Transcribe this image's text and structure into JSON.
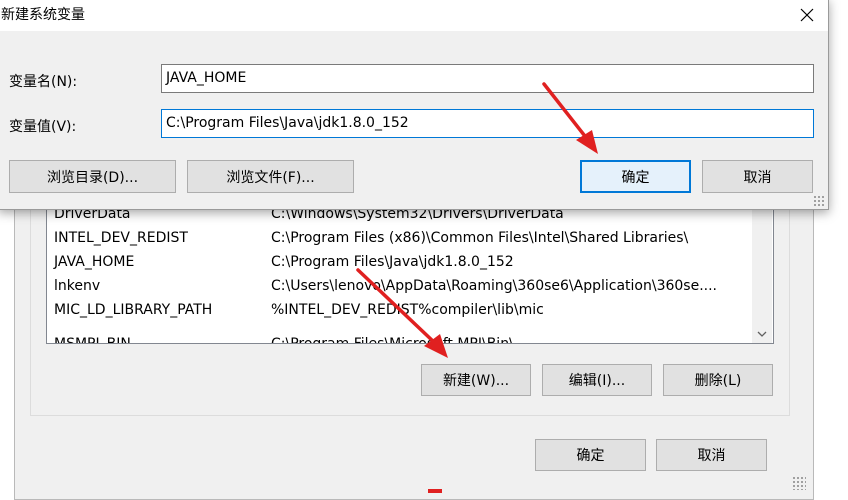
{
  "dialog": {
    "title": "新建系统变量",
    "name_label": "变量名(N):",
    "name_value": "JAVA_HOME",
    "value_label": "变量值(V):",
    "value_value": "C:\\Program Files\\Java\\jdk1.8.0_152",
    "browse_dir": "浏览目录(D)...",
    "browse_file": "浏览文件(F)...",
    "ok": "确定",
    "cancel": "取消",
    "close_icon": "close-icon"
  },
  "parent": {
    "rows": [
      {
        "name": "DriverData",
        "value": "C:\\Windows\\System32\\Drivers\\DriverData"
      },
      {
        "name": "INTEL_DEV_REDIST",
        "value": "C:\\Program Files (x86)\\Common Files\\Intel\\Shared Libraries\\"
      },
      {
        "name": "JAVA_HOME",
        "value": "C:\\Program Files\\Java\\jdk1.8.0_152"
      },
      {
        "name": "lnkenv",
        "value": "C:\\Users\\lenovo\\AppData\\Roaming\\360se6\\Application\\360se...."
      },
      {
        "name": "MIC_LD_LIBRARY_PATH",
        "value": "%INTEL_DEV_REDIST%compiler\\lib\\mic"
      },
      {
        "name": "MSMPI_BIN",
        "value": "C:\\Program Files\\Microsoft MPI\\Bin\\"
      }
    ],
    "new_button": "新建(W)...",
    "edit_button": "编辑(I)...",
    "delete_button": "删除(L)",
    "ok": "确定",
    "cancel": "取消",
    "scroll_down_icon": "chevron-down-icon"
  },
  "colors": {
    "focus_accent": "#0078d7",
    "annotation_red": "#e02020",
    "dialog_bg": "#f0f0f0"
  }
}
